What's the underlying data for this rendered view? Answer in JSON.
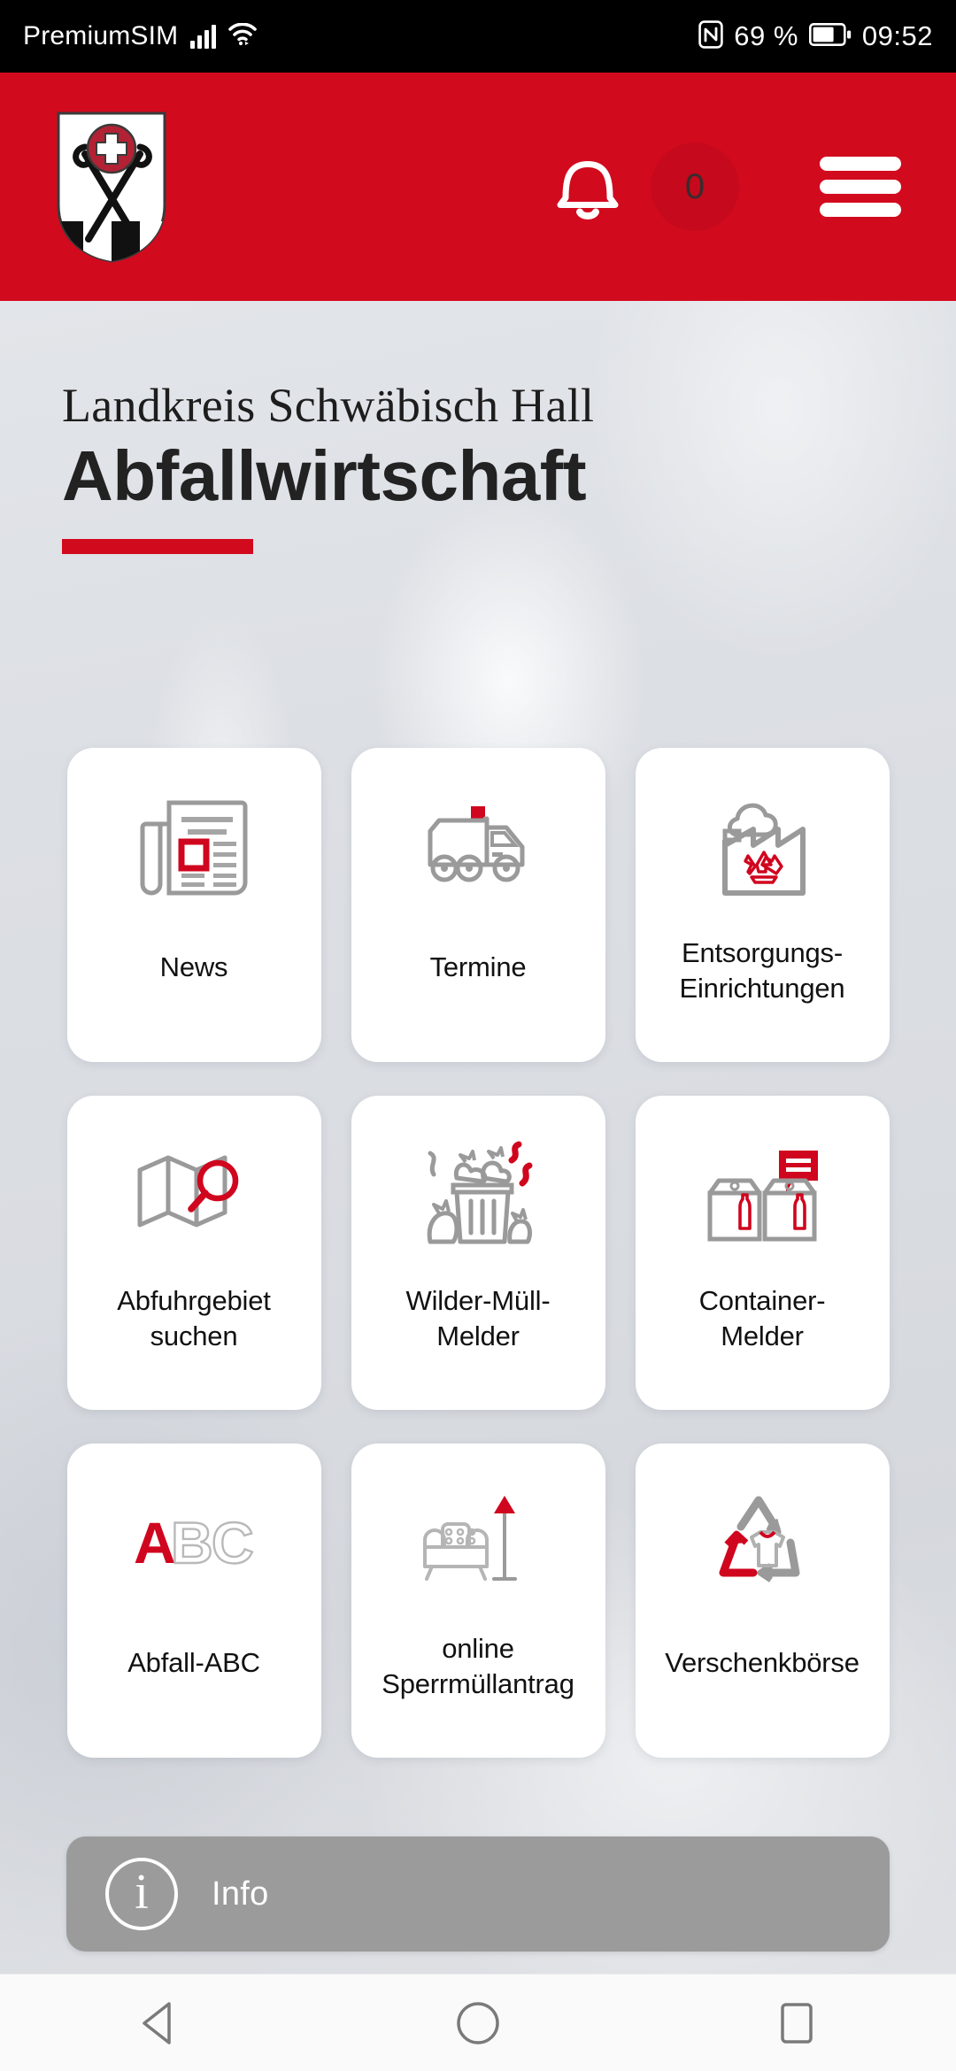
{
  "status_bar": {
    "carrier": "PremiumSIM",
    "signal_icon": "signal-bars-icon",
    "wifi_icon": "wifi-icon",
    "nfc_icon": "nfc-icon",
    "battery_percent": "69 %",
    "battery_icon": "battery-icon",
    "time": "09:52"
  },
  "header": {
    "logo_alt": "landkreis-schwaebisch-hall-coat-of-arms",
    "bell_icon": "notification-bell-icon",
    "notification_count": "0",
    "menu_icon": "hamburger-menu-icon",
    "background_color": "#d20a1e"
  },
  "title": {
    "subtitle": "Landkreis Schwäbisch Hall",
    "main": "Abfallwirtschaft",
    "accent_color": "#d20a1e"
  },
  "tiles": [
    {
      "id": "news",
      "label": "News",
      "icon": "newspaper-icon"
    },
    {
      "id": "termine",
      "label": "Termine",
      "icon": "garbage-truck-icon"
    },
    {
      "id": "entsorgung",
      "label": "Entsorgungs-Einrichtungen",
      "label_line1": "Entsorgungs-",
      "label_line2": "Einrichtungen",
      "icon": "factory-recycling-icon"
    },
    {
      "id": "abfuhrgebiet",
      "label": "Abfuhrgebiet suchen",
      "label_line1": "Abfuhrgebiet",
      "label_line2": "suchen",
      "icon": "map-search-icon"
    },
    {
      "id": "wilder-muell",
      "label": "Wilder-Müll-Melder",
      "label_line1": "Wilder-Müll-",
      "label_line2": "Melder",
      "icon": "overflowing-trash-icon"
    },
    {
      "id": "container",
      "label": "Container-Melder",
      "label_line1": "Container-",
      "label_line2": "Melder",
      "icon": "glass-container-icon"
    },
    {
      "id": "abfall-abc",
      "label": "Abfall-ABC",
      "icon": "abc-letters-icon"
    },
    {
      "id": "sperrmuell",
      "label": "online Sperrmüllantrag",
      "label_line1": "online",
      "label_line2": "Sperrmüllantrag",
      "icon": "sofa-lamp-icon"
    },
    {
      "id": "verschenkboerse",
      "label": "Verschenkbörse",
      "icon": "recycle-shirt-icon"
    }
  ],
  "info_bar": {
    "icon": "info-circle-icon",
    "label": "Info",
    "background_color": "#9b9b9b"
  },
  "nav_bar": {
    "back_icon": "back-triangle-icon",
    "home_icon": "home-circle-icon",
    "recents_icon": "recents-square-icon"
  }
}
